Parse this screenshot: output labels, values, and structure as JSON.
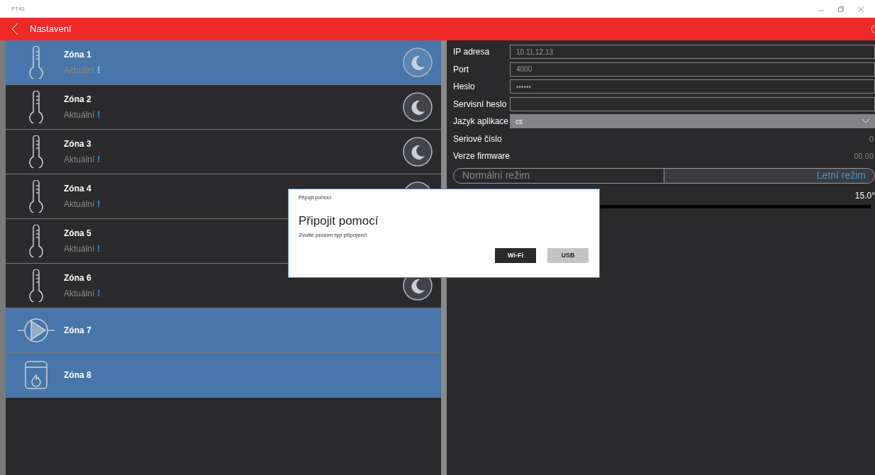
{
  "window": {
    "title": "PT41"
  },
  "header": {
    "title": "Nastavení"
  },
  "zones": [
    {
      "kind": "thermometer",
      "name": "Zóna 1",
      "status": "Aktuální",
      "alert": "!",
      "moon": true,
      "selected": true
    },
    {
      "kind": "thermometer",
      "name": "Zóna 2",
      "status": "Aktuální",
      "alert": "!",
      "moon": true,
      "selected": false
    },
    {
      "kind": "thermometer",
      "name": "Zóna 3",
      "status": "Aktuální",
      "alert": "!",
      "moon": true,
      "selected": false
    },
    {
      "kind": "thermometer",
      "name": "Zóna 4",
      "status": "Aktuální",
      "alert": "!",
      "moon": true,
      "selected": false
    },
    {
      "kind": "thermometer",
      "name": "Zóna 5",
      "status": "Aktuální",
      "alert": "!",
      "moon": false,
      "selected": false
    },
    {
      "kind": "thermometer",
      "name": "Zóna 6",
      "status": "Aktuální",
      "alert": "!",
      "moon": true,
      "selected": false
    },
    {
      "kind": "pump",
      "name": "Zóna 7",
      "selected": true
    },
    {
      "kind": "boiler",
      "name": "Zóna 8",
      "selected": true
    }
  ],
  "settings": [
    {
      "kind": "input",
      "label": "IP adresa",
      "value": "10.11.12.13"
    },
    {
      "kind": "input",
      "label": "Port",
      "value": "4000"
    },
    {
      "kind": "input",
      "label": "Heslo",
      "value": "••••••"
    },
    {
      "kind": "input",
      "label": "Servisní heslo"
    },
    {
      "kind": "select",
      "label": "Jazyk aplikace",
      "value": "cs"
    },
    {
      "kind": "info",
      "label": "Seriové číslo",
      "value": "0"
    },
    {
      "kind": "info",
      "label": "Verze firmware",
      "value": "00.00"
    }
  ],
  "modes": [
    {
      "label": "Normální režim",
      "selected": false
    },
    {
      "label": "Letní režim",
      "selected": true
    }
  ],
  "temperature": {
    "value": "15.0°"
  },
  "dialog": {
    "caption": "Připojit pomocí",
    "title": "Připojit pomocí",
    "message": "Zvolte prosím typ připojení!",
    "buttons": [
      {
        "label": "Wi-Fi",
        "primary": true
      },
      {
        "label": "USB",
        "primary": false
      }
    ]
  }
}
